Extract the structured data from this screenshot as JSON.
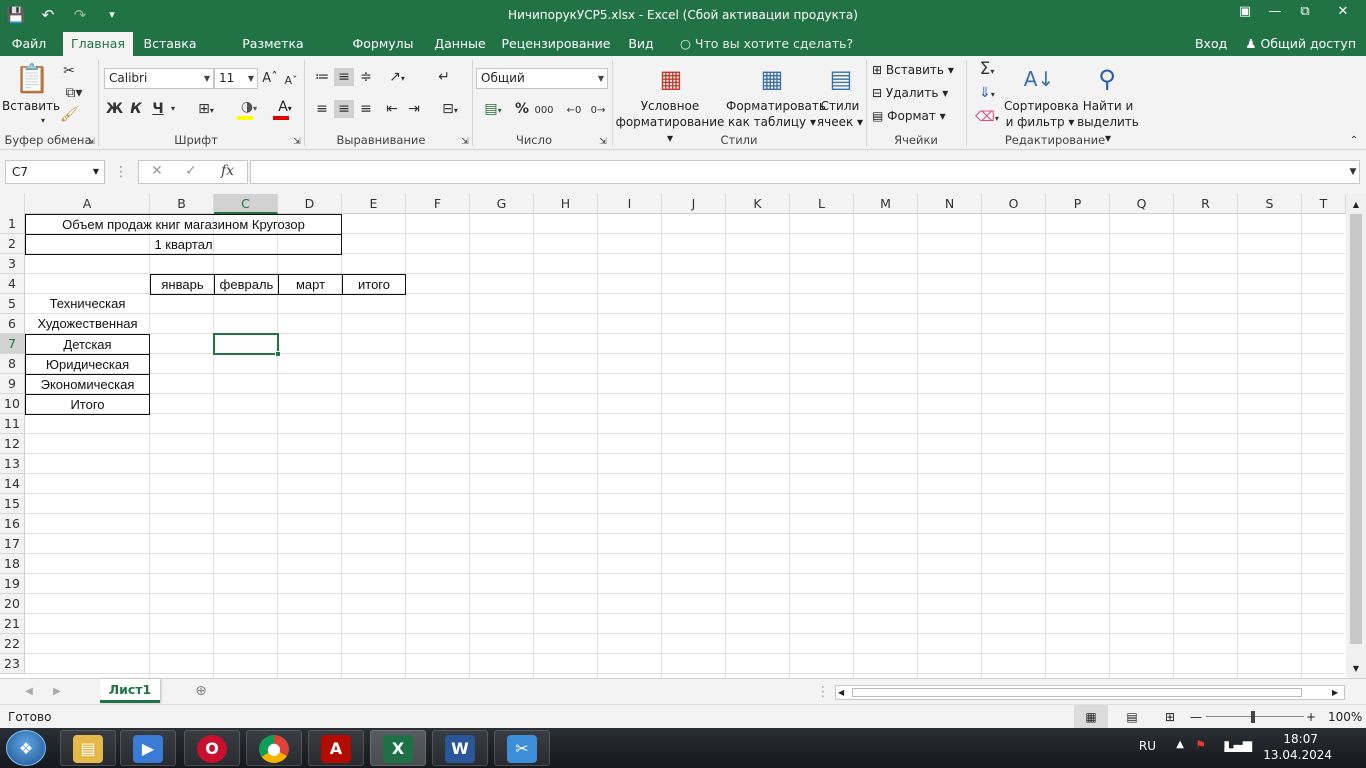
{
  "window": {
    "title": "НичипорукУСР5.xlsx - Excel (Сбой активации продукта)"
  },
  "tabs": {
    "items": [
      "Файл",
      "Главная",
      "Вставка",
      "Разметка страницы",
      "Формулы",
      "Данные",
      "Рецензирование",
      "Вид"
    ],
    "active": "Главная",
    "tell_me": "Что вы хотите сделать?",
    "signin": "Вход",
    "share": "Общий доступ"
  },
  "ribbon": {
    "clipboard": {
      "paste": "Вставить",
      "label": "Буфер обмена"
    },
    "font": {
      "name": "Calibri",
      "size": "11",
      "label": "Шрифт",
      "bold": "Ж",
      "italic": "К",
      "underline": "Ч"
    },
    "alignment": {
      "label": "Выравнивание"
    },
    "number": {
      "format": "Общий",
      "label": "Число",
      "percent": "%",
      "thousands": "000"
    },
    "styles": {
      "conditional_line1": "Условное",
      "conditional_line2": "форматирование",
      "table_line1": "Форматировать",
      "table_line2": "как таблицу",
      "cell_line1": "Стили",
      "cell_line2": "ячеек",
      "label": "Стили"
    },
    "cells": {
      "insert": "Вставить",
      "delete": "Удалить",
      "format": "Формат",
      "label": "Ячейки"
    },
    "editing": {
      "sort_line1": "Сортировка",
      "sort_line2": "и фильтр",
      "find_line1": "Найти и",
      "find_line2": "выделить",
      "label": "Редактирование"
    }
  },
  "formula_bar": {
    "name_box": "C7",
    "fx": "fx",
    "formula": ""
  },
  "grid": {
    "columns": [
      "A",
      "B",
      "C",
      "D",
      "E",
      "F",
      "G",
      "H",
      "I",
      "J",
      "K",
      "L",
      "M",
      "N",
      "O",
      "P",
      "Q",
      "R",
      "S",
      "T"
    ],
    "rows": [
      "1",
      "2",
      "3",
      "4",
      "5",
      "6",
      "7",
      "8",
      "9",
      "10",
      "11",
      "12",
      "13",
      "14",
      "15",
      "16",
      "17",
      "18",
      "19",
      "20",
      "21",
      "22",
      "23"
    ],
    "selected_col": "C",
    "selected_row": "7"
  },
  "cells": {
    "A1": "Объем продаж книг магазином Кругозор",
    "A2": "1 квартал",
    "B4": "январь",
    "C4": "февраль",
    "D4": "март",
    "E4": "итого",
    "A5": "Техническая",
    "A6": "Художественная",
    "A7": "Детская",
    "A8": "Юридическая",
    "A9": "Экономическая",
    "A10": "Итого"
  },
  "sheets": {
    "active": "Лист1"
  },
  "status": {
    "ready": "Готово",
    "zoom": "100%"
  },
  "taskbar": {
    "lang": "RU",
    "time": "18:07",
    "date": "13.04.2024"
  },
  "colors": {
    "accent": "#217346",
    "taskbar": "#1b1f24"
  }
}
